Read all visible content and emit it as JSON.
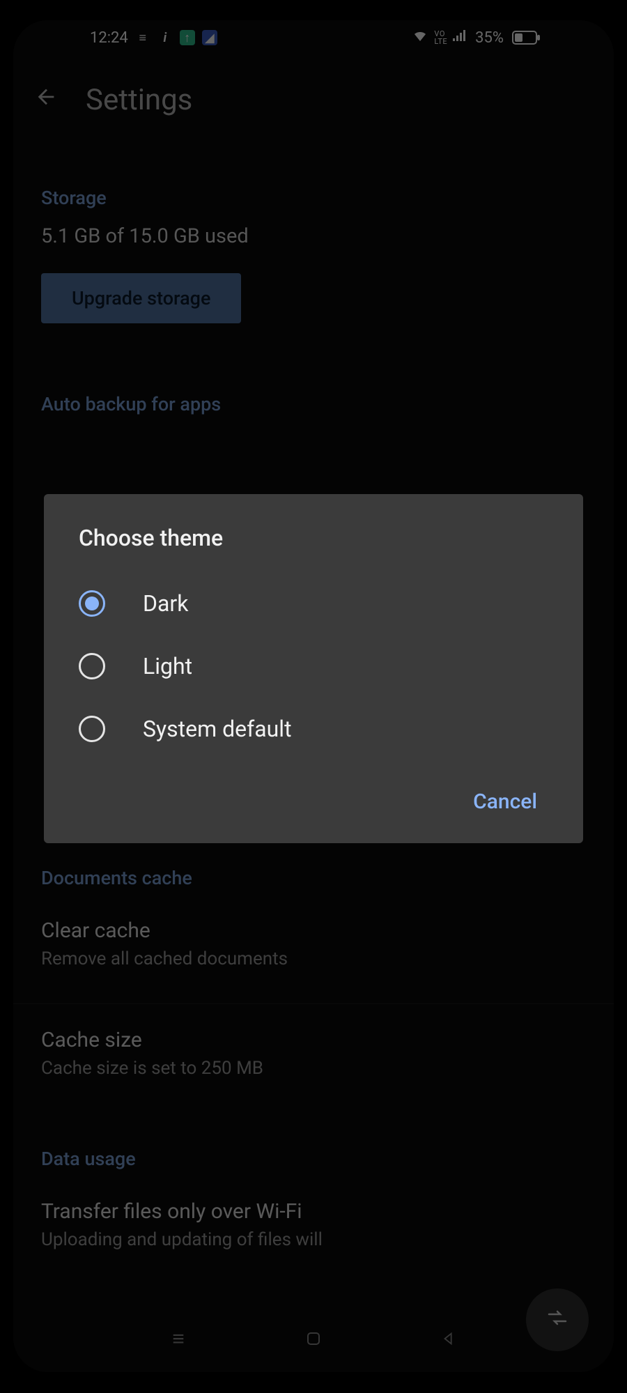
{
  "status": {
    "time": "12:24",
    "battery_pct": "35%",
    "battery_fill_pct": 35,
    "volte": "VO\nLTE"
  },
  "app_bar": {
    "title": "Settings"
  },
  "storage": {
    "header": "Storage",
    "usage": "5.1 GB of 15.0 GB used",
    "upgrade_label": "Upgrade storage"
  },
  "autobackup": {
    "header": "Auto backup for apps"
  },
  "dialog": {
    "title": "Choose theme",
    "options": [
      {
        "label": "Dark",
        "selected": true
      },
      {
        "label": "Light",
        "selected": false
      },
      {
        "label": "System default",
        "selected": false
      }
    ],
    "cancel": "Cancel"
  },
  "docs_cache": {
    "header": "Documents cache",
    "clear_title": "Clear cache",
    "clear_sub": "Remove all cached documents",
    "size_title": "Cache size",
    "size_sub": "Cache size is set to 250 MB"
  },
  "data_usage": {
    "header": "Data usage",
    "wifi_title": "Transfer files only over Wi-Fi",
    "wifi_sub": "Uploading and updating of files will"
  }
}
